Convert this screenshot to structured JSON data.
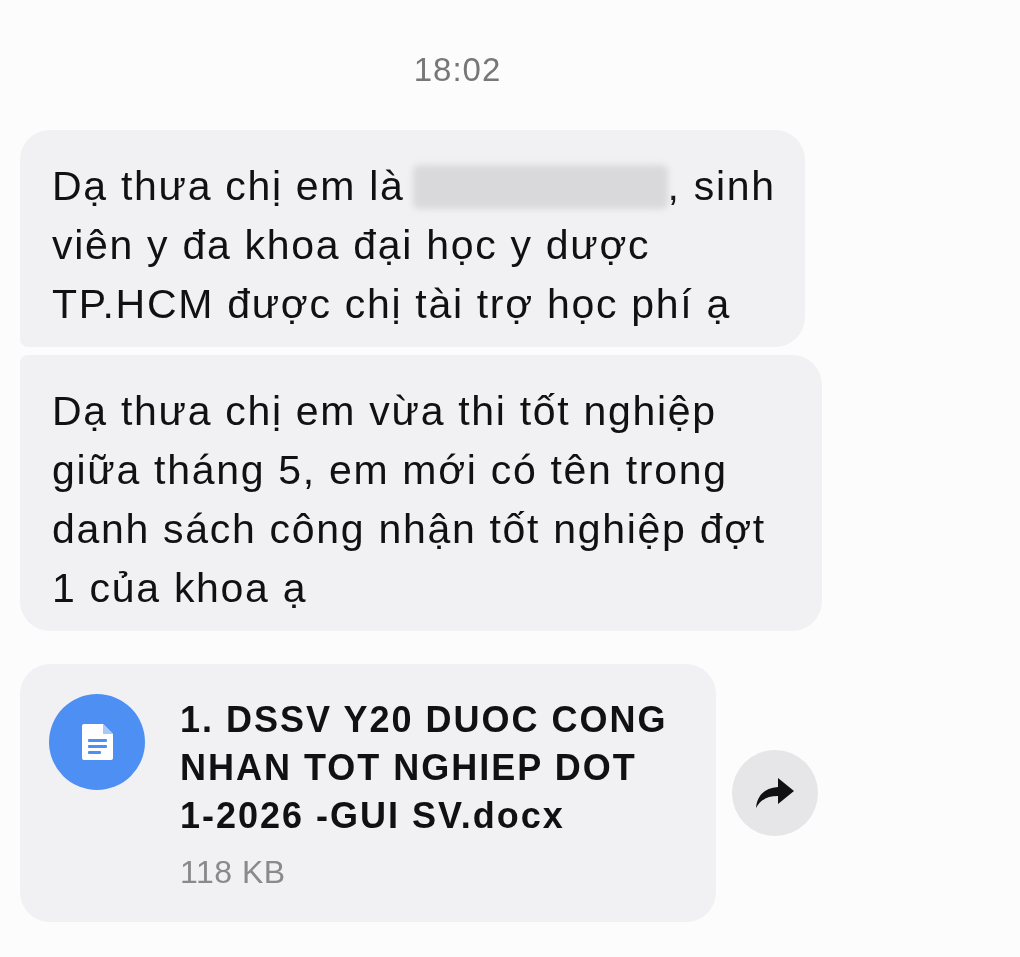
{
  "timestamp": "18:02",
  "messages": [
    {
      "kind": "text",
      "parts": [
        {
          "kind": "text",
          "text": "Dạ thưa chị em là"
        },
        {
          "kind": "redacted"
        },
        {
          "kind": "text",
          "text": ", sinh viên y đa khoa đại học y dược TP.HCM được chị tài trợ học phí ạ"
        }
      ]
    },
    {
      "kind": "text",
      "parts": [
        {
          "kind": "text",
          "text": "Dạ thưa chị em vừa thi tốt nghiệp giữa tháng 5, em mới có tên trong danh sách công nhận tốt nghiệp đợt 1 của khoa ạ"
        }
      ]
    },
    {
      "kind": "file",
      "file_name": "1. DSSV Y20 DUOC CONG NHAN TOT NGHIEP DOT 1-2026 -GUI SV.docx",
      "file_size": "118 KB",
      "forward_button": true
    }
  ]
}
